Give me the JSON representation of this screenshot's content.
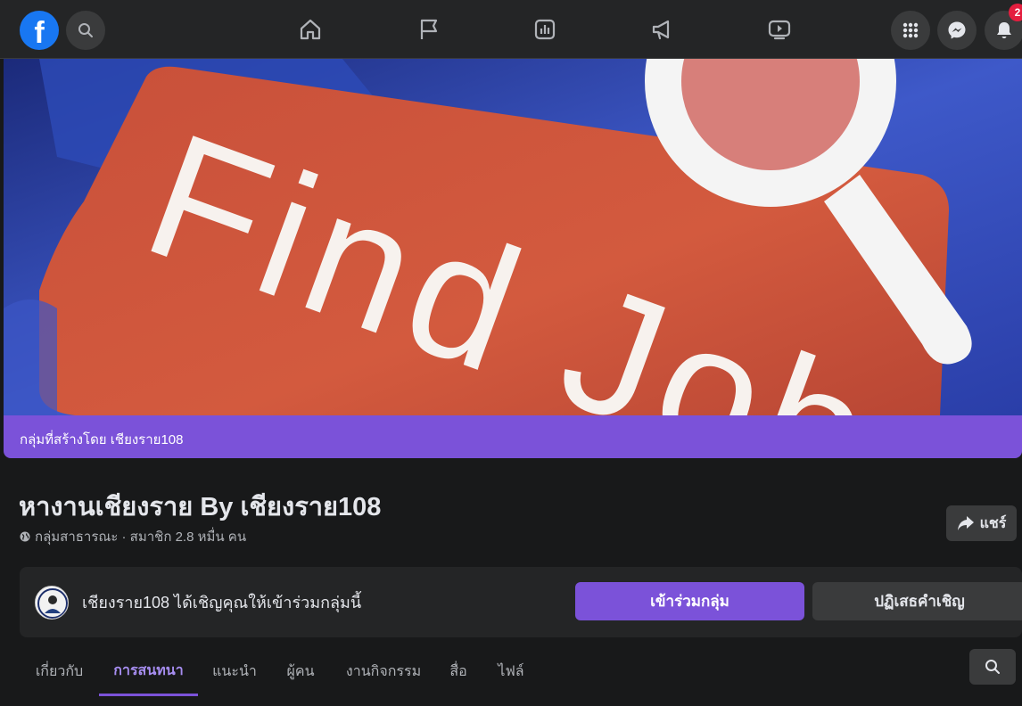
{
  "topbar": {
    "logo_letter": "f",
    "notifications_count": "2"
  },
  "cover": {
    "headline": "Find Job"
  },
  "group": {
    "created_by": "กลุ่มที่สร้างโดย เชียงราย108",
    "title": "หางานเชียงราย By เชียงราย108",
    "meta": "กลุ่มสาธารณะ · สมาชิก 2.8 หมื่น คน",
    "share_label": "แชร์"
  },
  "invite": {
    "text": "เชียงราย108 ได้เชิญคุณให้เข้าร่วมกลุ่มนี้",
    "join_label": "เข้าร่วมกลุ่ม",
    "decline_label": "ปฏิเสธคำเชิญ"
  },
  "tabs": [
    {
      "label": "เกี่ยวกับ"
    },
    {
      "label": "การสนทนา"
    },
    {
      "label": "แนะนำ"
    },
    {
      "label": "ผู้คน"
    },
    {
      "label": "งานกิจกรรม"
    },
    {
      "label": "สื่อ"
    },
    {
      "label": "ไฟล์"
    }
  ],
  "colors": {
    "accent": "#7b52d9",
    "facebook_blue": "#1877f2",
    "background": "#18191a",
    "surface": "#242526"
  }
}
